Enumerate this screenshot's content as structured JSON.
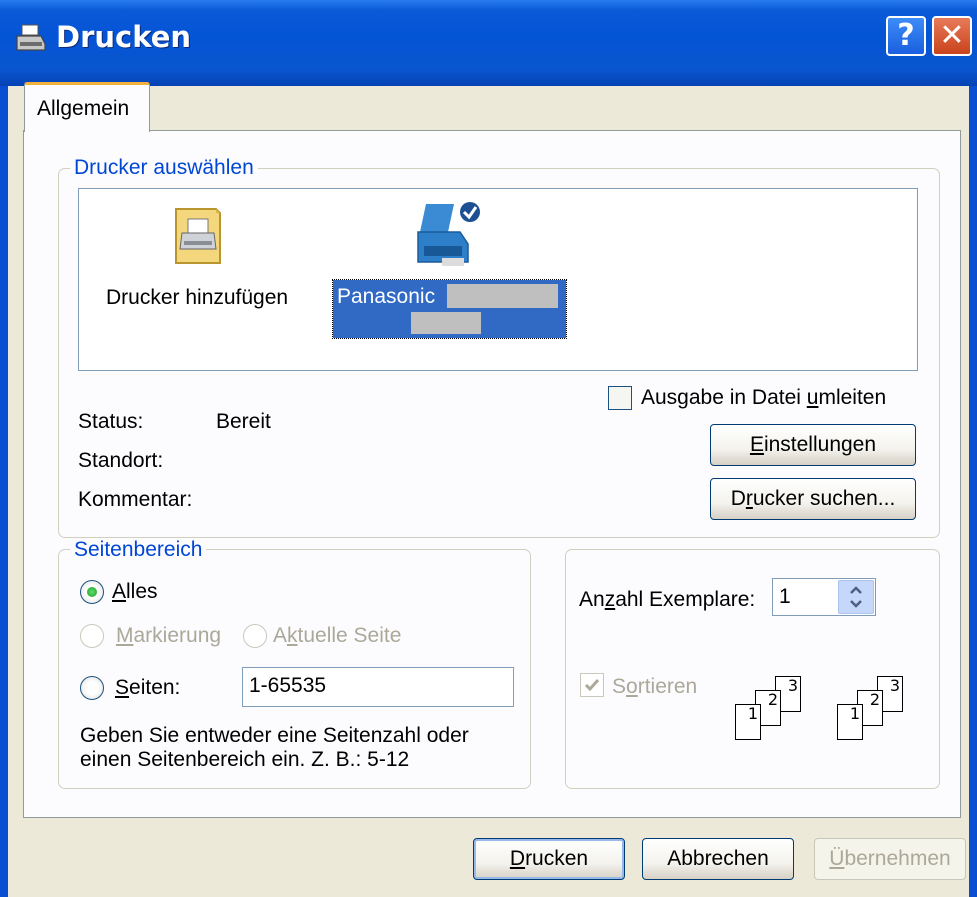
{
  "window": {
    "title": "Drucken",
    "help_glyph": "?",
    "close_glyph": "✕"
  },
  "tabs": [
    {
      "label": "Allgemein"
    }
  ],
  "printer_group": {
    "legend": "Drucker auswählen",
    "items": [
      {
        "label": "Drucker hinzufügen",
        "icon": "add-printer-icon"
      },
      {
        "label": "Panasonic",
        "icon": "default-printer-icon",
        "selected": true
      }
    ],
    "print_to_file": {
      "label_pre": "Ausgabe in Datei ",
      "label_accel": "u",
      "label_post": "mleiten",
      "checked": false
    },
    "status_label": "Status:",
    "status_value": "Bereit",
    "location_label": "Standort:",
    "comment_label": "Kommentar:",
    "settings_button": {
      "accel": "E",
      "rest": "instellungen"
    },
    "find_button": {
      "pre": "D",
      "accel": "r",
      "rest": "ucker suchen..."
    }
  },
  "page_range": {
    "legend": "Seitenbereich",
    "all": {
      "accel": "A",
      "rest": "lles",
      "selected": true
    },
    "selection": {
      "accel": "M",
      "rest": "arkierung",
      "enabled": false
    },
    "current_page": {
      "pre": "A",
      "accel": "k",
      "rest": "tuelle Seite",
      "enabled": false
    },
    "pages": {
      "accel": "S",
      "rest": "eiten:",
      "selected": false
    },
    "pages_value": "1-65535",
    "hint_line1": "Geben Sie entweder eine Seitenzahl oder",
    "hint_line2": "einen Seitenbereich ein. Z. B.: 5-12"
  },
  "copies": {
    "label_pre": "An",
    "label_accel": "z",
    "label_post": "ahl Exemplare:",
    "value": "1",
    "collate": {
      "pre": "S",
      "accel": "o",
      "rest": "rtieren",
      "checked": true,
      "enabled": false
    },
    "page_numbers": [
      "1",
      "2",
      "3"
    ]
  },
  "buttons": {
    "print": {
      "accel": "D",
      "rest": "rucken"
    },
    "cancel": "Abbrechen",
    "apply": {
      "accel": "Ü",
      "rest": "bernehmen",
      "enabled": false
    }
  },
  "colors": {
    "titlebar": "#0454d6",
    "accent": "#0046d5",
    "selection": "#316ac5"
  }
}
